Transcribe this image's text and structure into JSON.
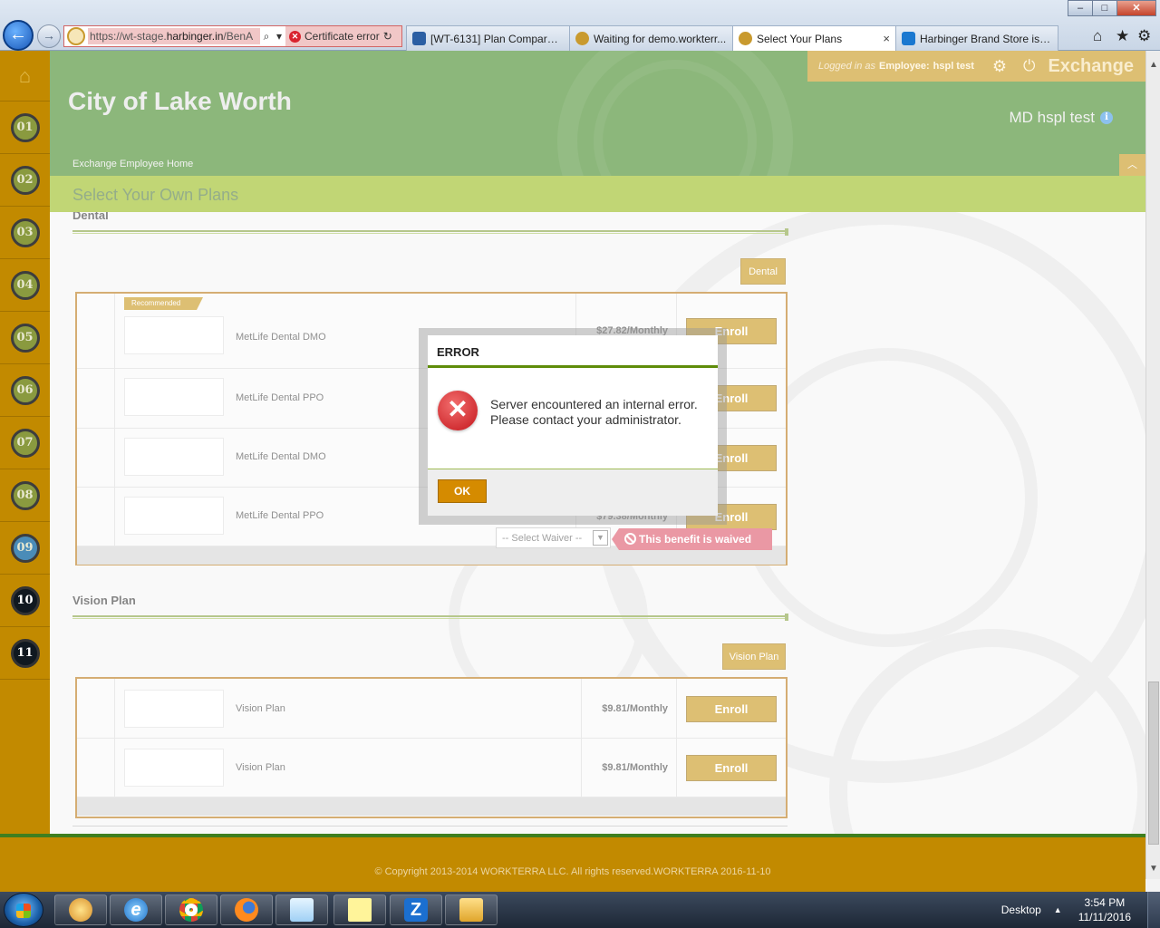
{
  "browser": {
    "url_prefix": "https://wt-stage.",
    "url_domain": "harbinger.in",
    "url_suffix": "/BenA",
    "cert_error": "Certificate error",
    "tabs": [
      {
        "label": "[WT-6131] Plan Compare B...",
        "icon": "jira-icon",
        "color": "#2b5fa3"
      },
      {
        "label": "Waiting for demo.workterr...",
        "icon": "workterra-icon",
        "color": "#c99a2e"
      },
      {
        "label": "Select Your Plans",
        "icon": "workterra-icon",
        "color": "#c99a2e",
        "active": true
      },
      {
        "label": "Harbinger Brand Store is B...",
        "icon": "sap-icon",
        "color": "#1a78d0"
      }
    ],
    "tab_close": "×",
    "window_buttons": {
      "minimize": "–",
      "maximize": "□",
      "close": "✕"
    }
  },
  "rail": {
    "home_icon": "home-icon",
    "steps": [
      {
        "num": "01",
        "state": "done"
      },
      {
        "num": "02",
        "state": "done"
      },
      {
        "num": "03",
        "state": "done"
      },
      {
        "num": "04",
        "state": "done"
      },
      {
        "num": "05",
        "state": "done"
      },
      {
        "num": "06",
        "state": "done"
      },
      {
        "num": "07",
        "state": "done"
      },
      {
        "num": "08",
        "state": "done"
      },
      {
        "num": "09",
        "state": "current"
      },
      {
        "num": "10",
        "state": "todo"
      },
      {
        "num": "11",
        "state": "todo"
      }
    ]
  },
  "header": {
    "org_title": "City of Lake Worth",
    "breadcrumb": "Exchange Employee Home",
    "logged_in_prefix": "Logged in as",
    "role": "Employee:",
    "user": "hspl test",
    "app_name": "Exchange",
    "person_name": "MD hspl test",
    "info_glyph": "i"
  },
  "section": {
    "title": "Select Your Own Plans"
  },
  "dental": {
    "title": "Dental",
    "category_button": "Dental",
    "recommended": "Recommended",
    "plans": [
      {
        "name": "MetLife Dental DMO",
        "price": "$27.82/Monthly",
        "action": "Enroll"
      },
      {
        "name": "MetLife Dental PPO",
        "price": "",
        "action": "Enroll"
      },
      {
        "name": "MetLife Dental DMO",
        "price": "",
        "action": "Enroll"
      },
      {
        "name": "MetLife Dental PPO",
        "price": "$79.38/Monthly",
        "action": "Enroll"
      }
    ],
    "waiver_placeholder": "-- Select Waiver --",
    "waived_text": "This benefit is waived"
  },
  "vision": {
    "title": "Vision Plan",
    "category_button": "Vision Plan",
    "plans": [
      {
        "name": "Vision Plan",
        "price": "$9.81/Monthly",
        "action": "Enroll"
      },
      {
        "name": "Vision Plan",
        "price": "$9.81/Monthly",
        "action": "Enroll"
      }
    ]
  },
  "dialog": {
    "title": "ERROR",
    "message": "Server encountered an internal error. Please contact your administrator.",
    "ok": "OK",
    "icon": "error-icon"
  },
  "footer": {
    "copyright": "© Copyright 2013-2014 WORKTERRA LLC. All rights reserved.WORKTERRA 2016-11-10"
  },
  "taskbar": {
    "apps": [
      "paint-icon",
      "ie-icon",
      "chrome-icon",
      "firefox-icon",
      "notepad-icon",
      "sticky-notes-icon",
      "zoom-icon",
      "explorer-icon"
    ],
    "desktop_label": "Desktop",
    "tray_arrow": "▲",
    "time": "3:54 PM",
    "date": "11/11/2016"
  },
  "colors": {
    "accent": "#c28a00",
    "header_green": "#2f7d10",
    "bar_green": "#8fb405",
    "waived_red": "#d9445a"
  }
}
